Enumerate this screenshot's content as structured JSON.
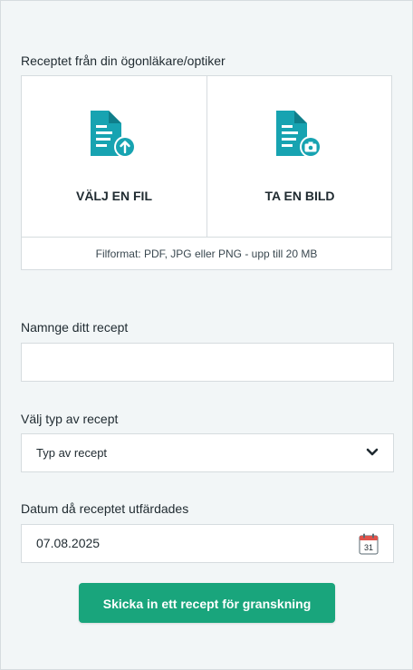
{
  "upload": {
    "label": "Receptet från din ögonläkare/optiker",
    "choose_file_label": "VÄLJ EN FIL",
    "take_photo_label": "TA EN BILD",
    "hint": "Filformat: PDF, JPG eller PNG - upp till 20 MB",
    "icons": [
      "document-upload-icon",
      "document-camera-icon"
    ]
  },
  "name_field": {
    "label": "Namnge ditt recept",
    "value": "",
    "placeholder": ""
  },
  "type_select": {
    "label": "Välj typ av recept",
    "selected": "Typ av recept",
    "icon": "chevron-down-icon"
  },
  "date_field": {
    "label": "Datum då receptet utfärdades",
    "value": "07.08.2025",
    "icon": "calendar-icon",
    "calendar_day": "31"
  },
  "submit": {
    "label": "Skicka in ett recept för granskning"
  },
  "colors": {
    "accent": "#19a57c",
    "icon_teal": "#17a3b1",
    "background": "#f2f6f7",
    "calendar_red": "#e0524a"
  }
}
